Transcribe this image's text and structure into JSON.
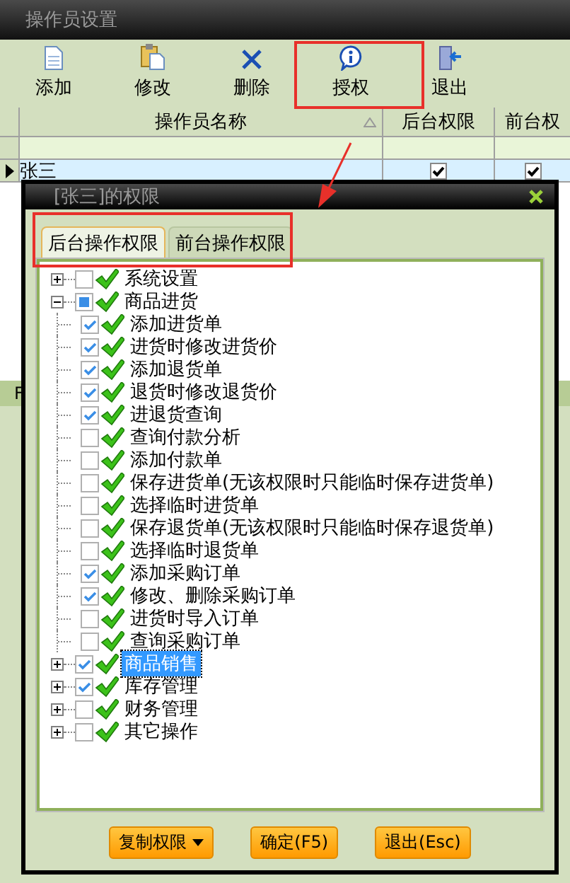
{
  "window": {
    "title": "操作员设置"
  },
  "toolbar": [
    {
      "label": "添加",
      "kind": "add"
    },
    {
      "label": "修改",
      "kind": "edit"
    },
    {
      "label": "删除",
      "kind": "delete"
    },
    {
      "label": "授权",
      "kind": "authorize"
    },
    {
      "label": "退出",
      "kind": "exit"
    }
  ],
  "table": {
    "columns": [
      "操作员名称",
      "后台权限",
      "前台权"
    ],
    "rows": [
      {
        "name": "张三",
        "current": true,
        "backend": true,
        "frontend": true
      }
    ]
  },
  "status_bar": "F",
  "dialog": {
    "title": "[张三]的权限",
    "tabs": [
      {
        "label": "后台操作权限",
        "selected": true
      },
      {
        "label": "前台操作权限",
        "selected": false
      }
    ],
    "tree": [
      {
        "label": "系统设置",
        "expanded": false,
        "checked": false,
        "partial": false,
        "selected": false
      },
      {
        "label": "商品进货",
        "expanded": true,
        "checked": false,
        "partial": true,
        "selected": false,
        "children": [
          {
            "label": "添加进货单",
            "checked": true
          },
          {
            "label": "进货时修改进货价",
            "checked": true
          },
          {
            "label": "添加退货单",
            "checked": true
          },
          {
            "label": "退货时修改退货价",
            "checked": true
          },
          {
            "label": "进退货查询",
            "checked": true
          },
          {
            "label": "查询付款分析",
            "checked": false
          },
          {
            "label": "添加付款单",
            "checked": false
          },
          {
            "label": "保存进货单(无该权限时只能临时保存进货单)",
            "checked": false
          },
          {
            "label": "选择临时进货单",
            "checked": false
          },
          {
            "label": "保存退货单(无该权限时只能临时保存退货单)",
            "checked": false
          },
          {
            "label": "选择临时退货单",
            "checked": false
          },
          {
            "label": "添加采购订单",
            "checked": true
          },
          {
            "label": "修改、删除采购订单",
            "checked": true
          },
          {
            "label": "进货时导入订单",
            "checked": false
          },
          {
            "label": "查询采购订单",
            "checked": false
          }
        ]
      },
      {
        "label": "商品销售",
        "expanded": false,
        "checked": true,
        "partial": false,
        "selected": true
      },
      {
        "label": "库存管理",
        "expanded": false,
        "checked": true,
        "partial": false,
        "selected": false
      },
      {
        "label": "财务管理",
        "expanded": false,
        "checked": false,
        "partial": false,
        "selected": false
      },
      {
        "label": "其它操作",
        "expanded": false,
        "checked": false,
        "partial": false,
        "selected": false
      }
    ],
    "buttons": [
      {
        "label": "复制权限",
        "dropdown": true
      },
      {
        "label": "确定(F5)",
        "dropdown": false
      },
      {
        "label": "退出(Esc)",
        "dropdown": false
      }
    ]
  }
}
